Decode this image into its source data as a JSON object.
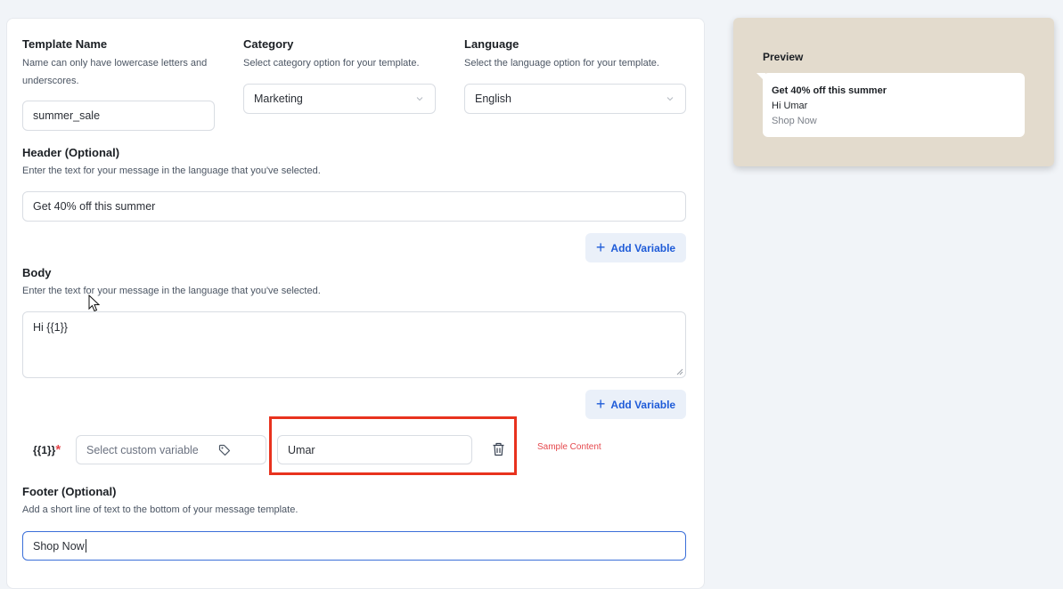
{
  "template_name": {
    "title": "Template Name",
    "description": "Name can only have lowercase letters and underscores.",
    "value": "summer_sale"
  },
  "category": {
    "title": "Category",
    "description": "Select category option for your template.",
    "value": "Marketing"
  },
  "language": {
    "title": "Language",
    "description": "Select the language option for your template.",
    "value": "English"
  },
  "header": {
    "title": "Header (Optional)",
    "description": "Enter the text for your message in the language that you've selected.",
    "value": "Get 40% off this summer",
    "add_variable_label": "Add Variable"
  },
  "body": {
    "title": "Body",
    "description": "Enter the text for your message in the language that you've selected.",
    "value": "Hi {{1}}",
    "add_variable_label": "Add Variable"
  },
  "variable_row": {
    "token": "{{1}}",
    "required_mark": "*",
    "custom_variable_placeholder": "Select custom variable",
    "sample_value": "Umar",
    "sample_hint": "Sample Content"
  },
  "footer": {
    "title": "Footer (Optional)",
    "description": "Add a short line of text to the bottom of your message template.",
    "value": "Shop Now"
  },
  "preview": {
    "title": "Preview",
    "header_line": "Get 40% off this summer",
    "body_line": "Hi Umar",
    "footer_line": "Shop Now"
  },
  "colors": {
    "accent": "#1e5bd8",
    "highlight_box": "#e8321e",
    "required": "#e5484d",
    "preview_bg": "#e3dbcd"
  },
  "icons": [
    "chevron-down-icon",
    "plus-icon",
    "tag-icon",
    "trash-icon"
  ]
}
